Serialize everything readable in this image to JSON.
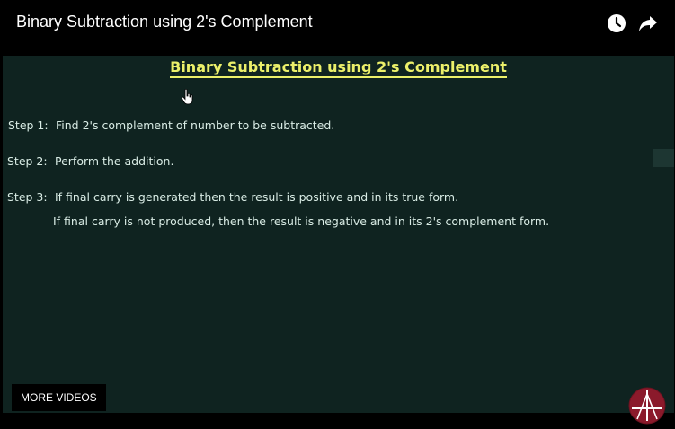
{
  "video": {
    "title": "Binary Subtraction using 2's Complement"
  },
  "controls": {
    "watch_later_icon": "clock-icon",
    "share_icon": "share-arrow-icon"
  },
  "lesson": {
    "heading": "Binary Subtraction using 2's Complement",
    "steps": [
      {
        "label": "Step 1:",
        "text": "Find 2's complement of number to be subtracted."
      },
      {
        "label": "Step 2:",
        "text": "Perform the addition."
      },
      {
        "label": "Step 3:",
        "text": "If final carry is generated then the result is positive and in its true form.",
        "text2": "If final carry is not produced, then the result is negative and in its 2's complement form."
      }
    ]
  },
  "footer": {
    "more_videos_label": "MORE VIDEOS",
    "channel_logo_icon": "channel-logo-icon"
  },
  "colors": {
    "board_background": "#0f2320",
    "heading_color": "#ecf06a",
    "chalk_text": "#d9ece5",
    "logo_red": "#8b1a2b"
  }
}
